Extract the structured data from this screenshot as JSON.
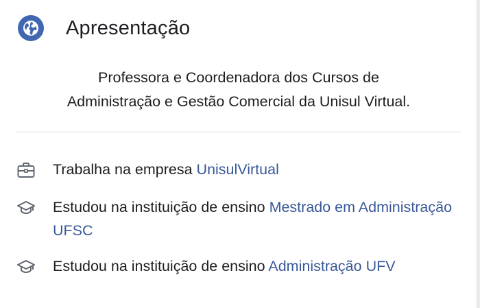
{
  "intro": {
    "title": "Apresentação",
    "icon": "globe-icon",
    "bio_line1": "Professora e Coordenadora dos Cursos de",
    "bio_line2": "Administração e Gestão Comercial da Unisul Virtual."
  },
  "details": [
    {
      "icon": "briefcase-icon",
      "prefix": "Trabalha na empresa ",
      "link": "UnisulVirtual"
    },
    {
      "icon": "graduation-cap-icon",
      "prefix": "Estudou na instituição de ensino ",
      "link": "Mestrado em Administração UFSC"
    },
    {
      "icon": "graduation-cap-icon",
      "prefix": "Estudou na instituição de ensino ",
      "link": "Administração UFV"
    }
  ],
  "colors": {
    "accent": "#4267b2",
    "link": "#385898",
    "text": "#1c1e21",
    "icon": "#606770"
  }
}
